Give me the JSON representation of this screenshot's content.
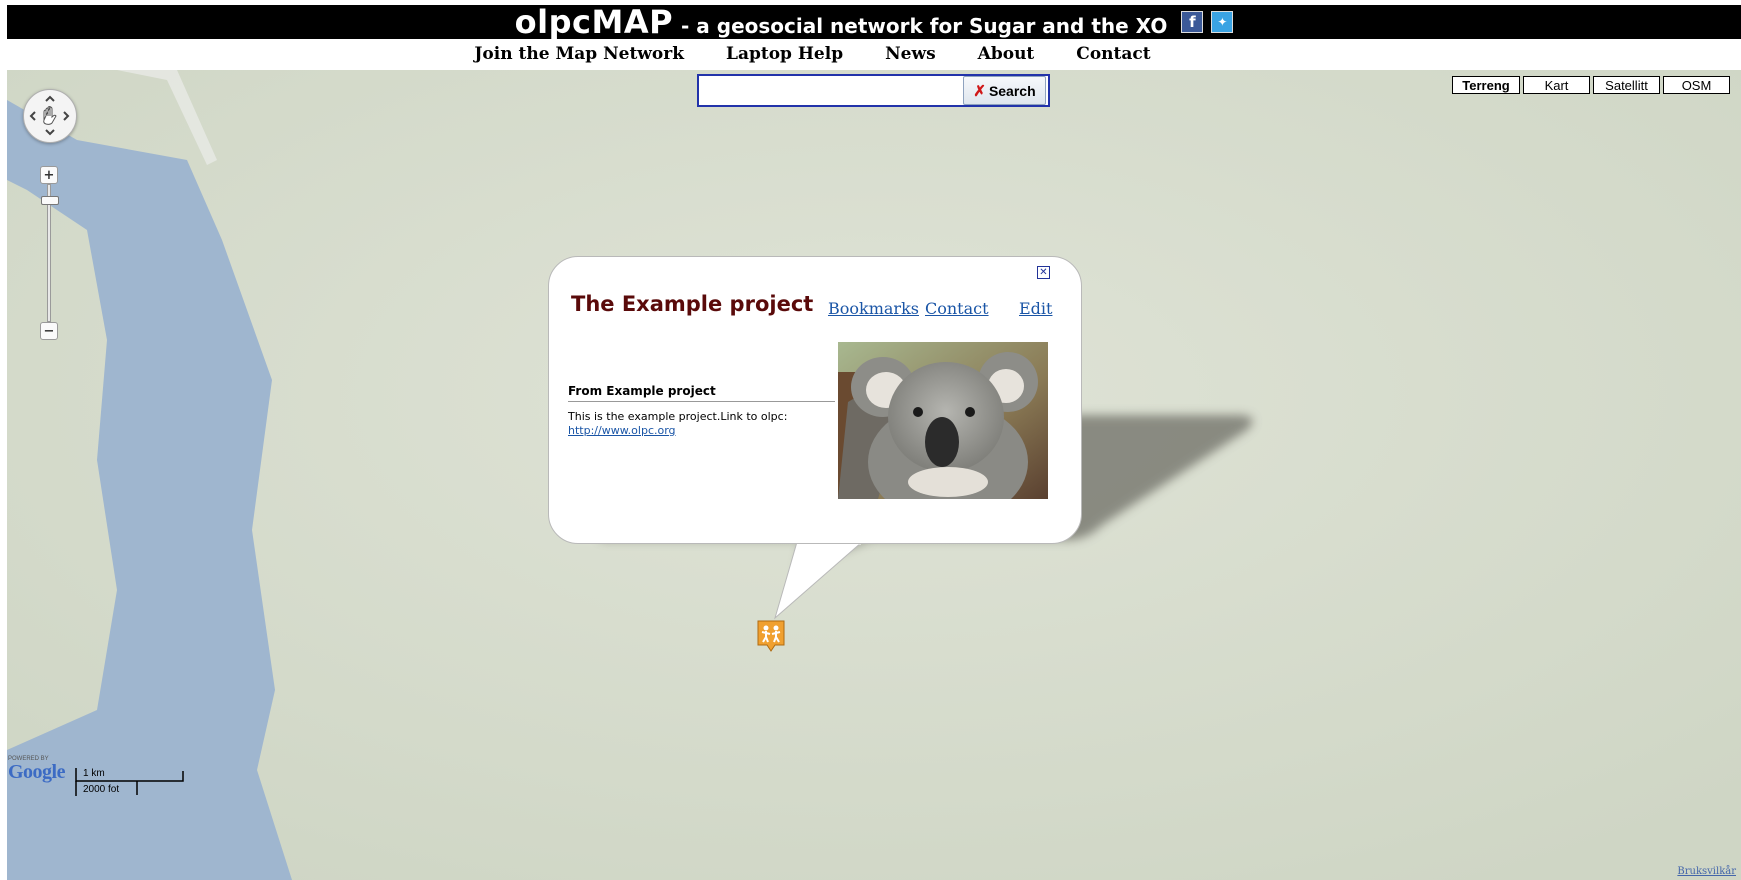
{
  "header": {
    "title": "olpcMAP",
    "tagline": "- a geosocial network for Sugar and the XO",
    "social": [
      {
        "name": "facebook-icon",
        "glyph": "f"
      },
      {
        "name": "twitter-icon",
        "glyph": "✦"
      }
    ]
  },
  "nav": {
    "items": [
      "Join the Map Network",
      "Laptop Help",
      "News",
      "About",
      "Contact"
    ]
  },
  "search": {
    "value": "",
    "placeholder": "",
    "button_label": "Search",
    "button_icon": "x-icon"
  },
  "map_types": {
    "items": [
      "Terreng",
      "Kart",
      "Satellitt",
      "OSM"
    ],
    "selected": "Terreng"
  },
  "controls": {
    "zoom_in": "+",
    "zoom_out": "−"
  },
  "info_window": {
    "title": "The Example project",
    "links": [
      "Bookmarks",
      "Contact",
      "Edit"
    ],
    "close_glyph": "✕",
    "subheading": "From Example project",
    "description": "This is the example project.Link to olpc:",
    "url": "http://www.olpc.org",
    "image": "koala-photo"
  },
  "map": {
    "marker_icon": "people-marker-icon",
    "google_powered": "POWERED BY",
    "google_logo": "Google",
    "scale_top": "1 km",
    "scale_bottom": "2000 fot",
    "terms": "Bruksvilkår",
    "colors": {
      "land": "#d6dccd",
      "water": "#9fb6cf",
      "marker": "#f0a030",
      "title": "#5a0a0a"
    }
  }
}
